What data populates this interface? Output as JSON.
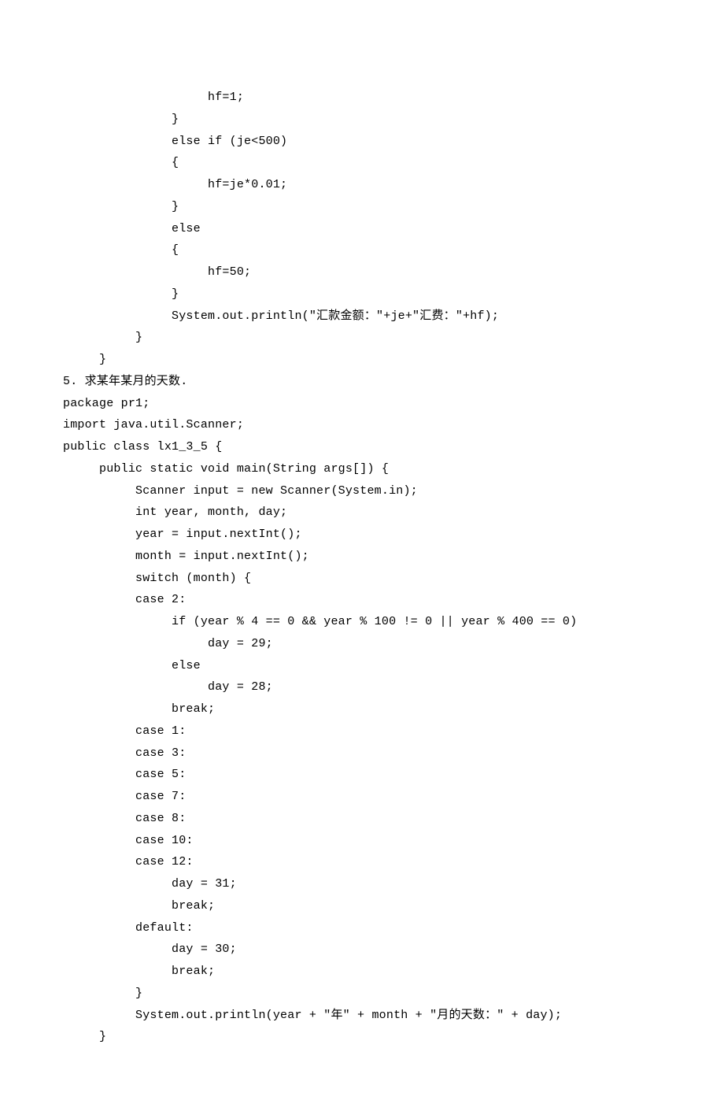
{
  "lines": [
    "                    hf=1;",
    "               }",
    "               else if (je<500)",
    "               {",
    "                    hf=je*0.01;",
    "               }",
    "               else",
    "               {",
    "                    hf=50;",
    "               }",
    "               System.out.println(\"汇款金额：\"+je+\"汇费：\"+hf);",
    "          }",
    "     }",
    "5. 求某年某月的天数.",
    "package pr1;",
    "import java.util.Scanner;",
    "public class lx1_3_5 {",
    "     public static void main(String args[]) {",
    "          Scanner input = new Scanner(System.in);",
    "          int year, month, day;",
    "          year = input.nextInt();",
    "          month = input.nextInt();",
    "          switch (month) {",
    "          case 2:",
    "               if (year % 4 == 0 && year % 100 != 0 || year % 400 == 0)",
    "                    day = 29;",
    "               else",
    "                    day = 28;",
    "               break;",
    "          case 1:",
    "          case 3:",
    "          case 5:",
    "          case 7:",
    "          case 8:",
    "          case 10:",
    "          case 12:",
    "               day = 31;",
    "               break;",
    "          default:",
    "               day = 30;",
    "               break;",
    "          }",
    "          System.out.println(year + \"年\" + month + \"月的天数：\" + day);",
    "     }"
  ]
}
